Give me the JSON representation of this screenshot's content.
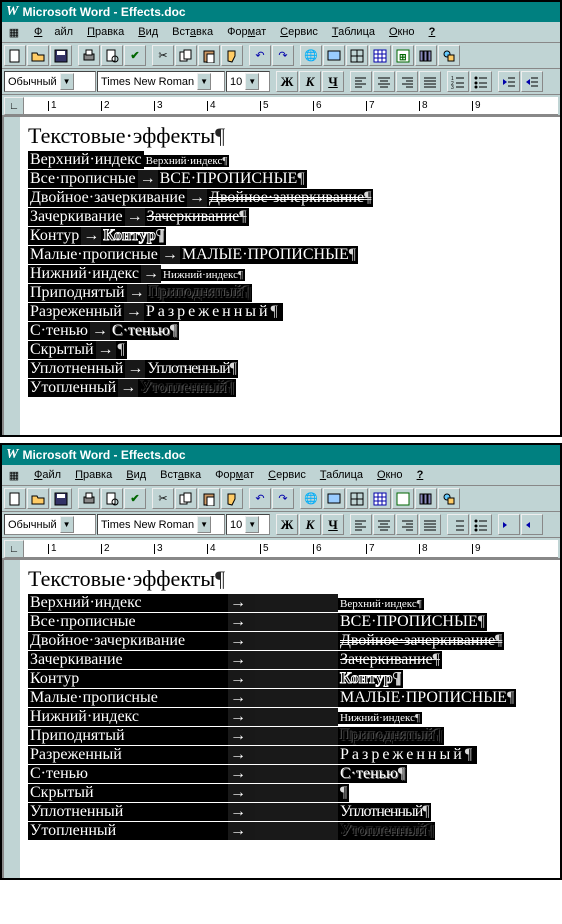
{
  "app": {
    "title": "Microsoft Word - Effects.doc",
    "menus": [
      "Файл",
      "Правка",
      "Вид",
      "Вставка",
      "Формат",
      "Сервис",
      "Таблица",
      "Окно",
      "?"
    ]
  },
  "combos": {
    "style": "Обычный",
    "font": "Times New Roman",
    "size": "10"
  },
  "fmt": {
    "bold": "Ж",
    "italic": "К",
    "underline": "Ч"
  },
  "ruler": {
    "marks": [
      "1",
      "2",
      "3",
      "4",
      "5",
      "6",
      "7",
      "8",
      "9"
    ]
  },
  "doc": {
    "title": "Текстовые·эффекты",
    "rows1": [
      {
        "label": "Верхний·индекс",
        "sep": "",
        "eff": "Верхний·индекс",
        "effClass": "sup"
      },
      {
        "label": "Все·прописные",
        "sep": "→",
        "eff": "ВСЕ·ПРОПИСНЫЕ",
        "effClass": ""
      },
      {
        "label": "Двойное·зачеркивание",
        "sep": " → ",
        "eff": "Двойное·зачеркивание",
        "effClass": "strike2"
      },
      {
        "label": "Зачеркивание",
        "sep": "  →  ",
        "eff": "Зачеркивание",
        "effClass": "strike1"
      },
      {
        "label": "Контур",
        "sep": "→",
        "eff": "Контур",
        "effClass": "outline"
      },
      {
        "label": "Малые·прописные",
        "sep": "   →   ",
        "eff": "МАЛЫЕ·ПРОПИСНЫЕ",
        "effClass": "smallcaps"
      },
      {
        "label": "Нижний·индекс",
        "sep": "→",
        "eff": "Нижний·индекс",
        "effClass": "sub"
      },
      {
        "label": "Приподнятый",
        "sep": " → ",
        "eff": "Приподнятый",
        "effClass": "embossed"
      },
      {
        "label": "Разреженный",
        "sep": " → ",
        "eff": "Разреженный",
        "effClass": "spread"
      },
      {
        "label": "С·тенью",
        "sep": "     →     ",
        "eff": "С·тенью",
        "effClass": "shadow"
      },
      {
        "label": "Скрытый",
        "sep": "     →   ",
        "eff": "",
        "effClass": ""
      },
      {
        "label": "Уплотненный",
        "sep": " → ",
        "eff": "Уплотненный",
        "effClass": "cond"
      },
      {
        "label": "Утопленный",
        "sep": "  →  ",
        "eff": "Утопленный",
        "effClass": "engraved"
      }
    ],
    "rows2": [
      {
        "label": "Верхний·индекс",
        "eff": "Верхний·индекс",
        "effClass": "sup"
      },
      {
        "label": "Все·прописные",
        "eff": "ВСЕ·ПРОПИСНЫЕ",
        "effClass": ""
      },
      {
        "label": "Двойное·зачеркивание",
        "eff": "Двойное·зачеркивание",
        "effClass": "strike2"
      },
      {
        "label": "Зачеркивание",
        "eff": "Зачеркивание",
        "effClass": "strike1"
      },
      {
        "label": "Контур",
        "eff": "Контур",
        "effClass": "outline"
      },
      {
        "label": "Малые·прописные",
        "eff": "МАЛЫЕ·ПРОПИСНЫЕ",
        "effClass": "smallcaps"
      },
      {
        "label": "Нижний·индекс",
        "eff": "Нижний·индекс",
        "effClass": "sub"
      },
      {
        "label": "Приподнятый",
        "eff": "Приподнятый",
        "effClass": "embossed"
      },
      {
        "label": "Разреженный",
        "eff": "Разреженный",
        "effClass": "spread"
      },
      {
        "label": "С·тенью",
        "eff": "С·тенью",
        "effClass": "shadow"
      },
      {
        "label": "Скрытый",
        "eff": "",
        "effClass": ""
      },
      {
        "label": "Уплотненный",
        "eff": "Уплотненный",
        "effClass": "cond"
      },
      {
        "label": "Утопленный",
        "eff": "Утопленный",
        "effClass": "engraved"
      }
    ]
  }
}
